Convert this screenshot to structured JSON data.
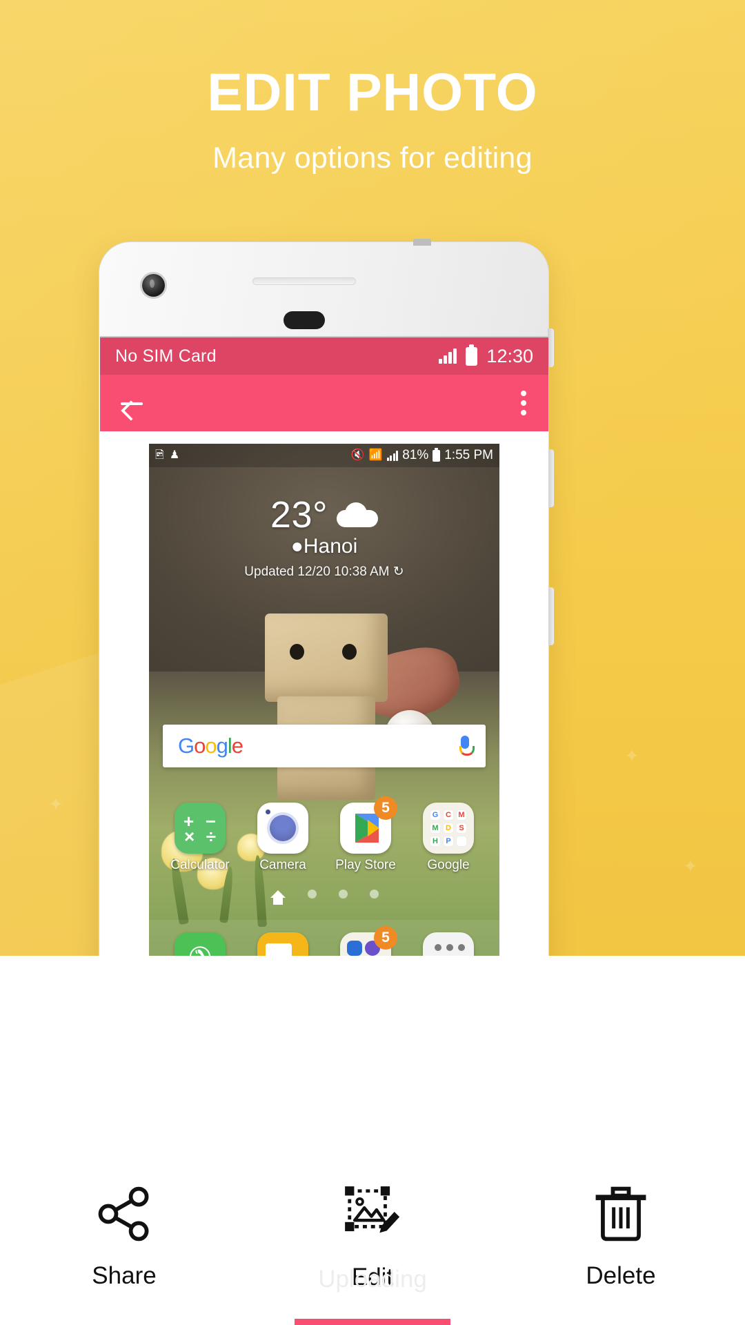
{
  "promo": {
    "title": "EDIT PHOTO",
    "subtitle": "Many options for editing",
    "bg_color": "#F3C846",
    "title_color": "#FFFFFF"
  },
  "phone": {
    "statusbar": {
      "carrier": "No SIM Card",
      "time": "12:30",
      "signal_icon": "signal-bars-icon",
      "battery_icon": "battery-icon",
      "bg_color": "#DE4463"
    },
    "appbar": {
      "back_icon": "back-arrow-icon",
      "overflow_icon": "kebab-menu-icon",
      "bg_color": "#F94E71"
    }
  },
  "inner_photo": {
    "statusbar": {
      "left_icons": [
        "image-icon",
        "person-icon"
      ],
      "mute_icon": "mute-vibrate-icon",
      "wifi_icon": "wifi-icon",
      "signal_icon": "signal-bars-icon",
      "battery_percent": "81%",
      "battery_icon": "battery-icon",
      "time": "1:55 PM"
    },
    "weather": {
      "temperature": "23°",
      "condition_icon": "cloud-icon",
      "location_icon": "location-pin-icon",
      "city": "Hanoi",
      "updated": "Updated 12/20 10:38 AM",
      "refresh_icon": "refresh-icon"
    },
    "search": {
      "logo": "Google",
      "logo_letters": [
        "G",
        "o",
        "o",
        "g",
        "l",
        "e"
      ],
      "mic_icon": "microphone-icon"
    },
    "apps": [
      {
        "label": "Calculator",
        "icon": "calculator-icon",
        "badge": null,
        "symbols": [
          "+",
          "−",
          "×",
          "÷"
        ]
      },
      {
        "label": "Camera",
        "icon": "camera-icon",
        "badge": null
      },
      {
        "label": "Play Store",
        "icon": "play-store-icon",
        "badge": "5"
      },
      {
        "label": "Google",
        "icon": "google-folder-icon",
        "badge": null,
        "mini": [
          "G",
          "C",
          "M",
          "M",
          "D",
          "S",
          "H",
          "P"
        ]
      }
    ],
    "pager": {
      "home_icon": "home-icon",
      "dots": 3,
      "active_index": 0
    },
    "dock": [
      {
        "icon": "phone-icon",
        "badge": null
      },
      {
        "icon": "messages-icon",
        "badge": null
      },
      {
        "icon": "folder-icon",
        "badge": "5"
      },
      {
        "icon": "app-drawer-icon",
        "badge": null
      }
    ]
  },
  "toolbar": {
    "ghost_text": "Uploading",
    "active_color": "#F94E71",
    "items": [
      {
        "label": "Share",
        "icon": "share-icon",
        "active": false
      },
      {
        "label": "Edit",
        "icon": "edit-image-icon",
        "active": true
      },
      {
        "label": "Delete",
        "icon": "trash-icon",
        "active": false
      }
    ]
  }
}
